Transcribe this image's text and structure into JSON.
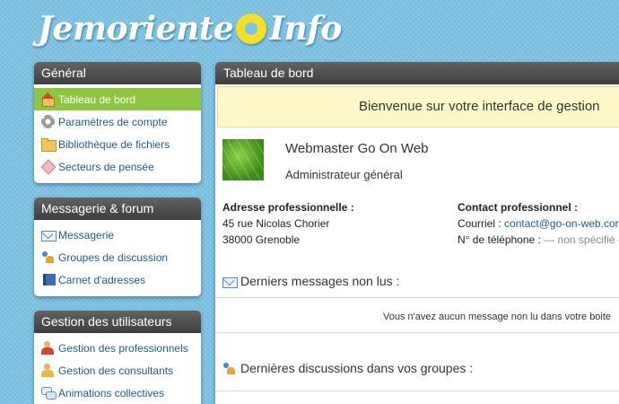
{
  "logo": {
    "left": "Jemoriente",
    "right": "Info"
  },
  "sidebar": {
    "general": {
      "title": "Général",
      "items": [
        {
          "label": "Tableau de bord",
          "icon": "home-icon",
          "active": true
        },
        {
          "label": "Paramètres de compte",
          "icon": "gear-icon"
        },
        {
          "label": "Bibliothèque de fichiers",
          "icon": "folder-icon"
        },
        {
          "label": "Secteurs de pensée",
          "icon": "tag-icon"
        }
      ]
    },
    "messaging": {
      "title": "Messagerie & forum",
      "items": [
        {
          "label": "Messagerie",
          "icon": "mail-icon"
        },
        {
          "label": "Groupes de discussion",
          "icon": "people-icon"
        },
        {
          "label": "Carnet d'adresses",
          "icon": "book-icon"
        }
      ]
    },
    "users": {
      "title": "Gestion des utilisateurs",
      "items": [
        {
          "label": "Gestion des professionnels",
          "icon": "users-icon"
        },
        {
          "label": "Gestion des consultants",
          "icon": "consultant-icon"
        },
        {
          "label": "Animations collectives",
          "icon": "chat-icon"
        }
      ]
    }
  },
  "main": {
    "title": "Tableau de bord",
    "welcome": "Bienvenue sur votre interface de gestion",
    "profile": {
      "name": "Webmaster Go On Web",
      "role": "Administrateur général"
    },
    "address": {
      "label": "Adresse professionnelle :",
      "line1": "45 rue Nicolas Chorier",
      "line2": "38000 Grenoble"
    },
    "contact": {
      "label": "Contact professionnel :",
      "email_label": "Courriel :",
      "email": "contact@go-on-web.com",
      "phone_label": "N° de téléphone :",
      "phone": "— non spécifié —"
    },
    "messages": {
      "title": "Derniers messages non lus :",
      "empty": "Vous n'avez aucun message non lu dans votre boite"
    },
    "discussions": {
      "title": "Dernières discussions dans vos groupes :"
    }
  },
  "colors": {
    "accent": "#8dc63f",
    "link": "#1d5a93",
    "background": "#7fc4e6",
    "header": "#4a4a4a"
  }
}
